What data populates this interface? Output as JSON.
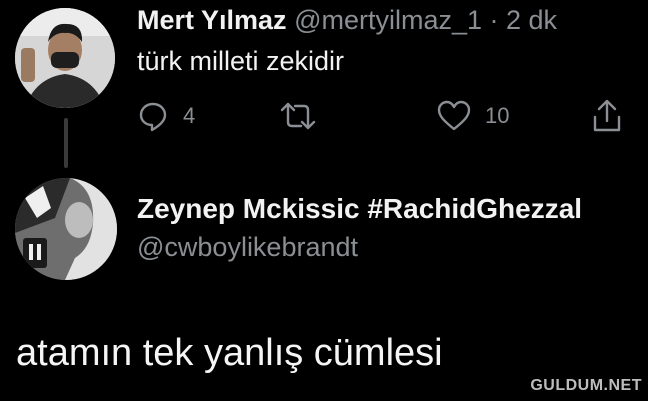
{
  "tweet1": {
    "author_name": "Mert Yılmaz",
    "handle_time": "@mertyilmaz_1 · 2 dk",
    "text": "türk milleti zekidir",
    "actions": {
      "reply_icon": "reply-icon",
      "reply_count": "4",
      "retweet_icon": "retweet-icon",
      "like_icon": "like-icon",
      "like_count": "10",
      "share_icon": "share-icon"
    }
  },
  "tweet2": {
    "author_name": "Zeynep Mckissic #RachidGhezzal",
    "handle": "@cwboylikebrandt"
  },
  "caption": "atamın tek yanlış cümlesi",
  "watermark": "GULDUM.NET",
  "colors": {
    "background": "#000000",
    "text": "#f2f2f2",
    "secondary_text": "#8b8f93",
    "thread_line": "#3a3a3a"
  }
}
